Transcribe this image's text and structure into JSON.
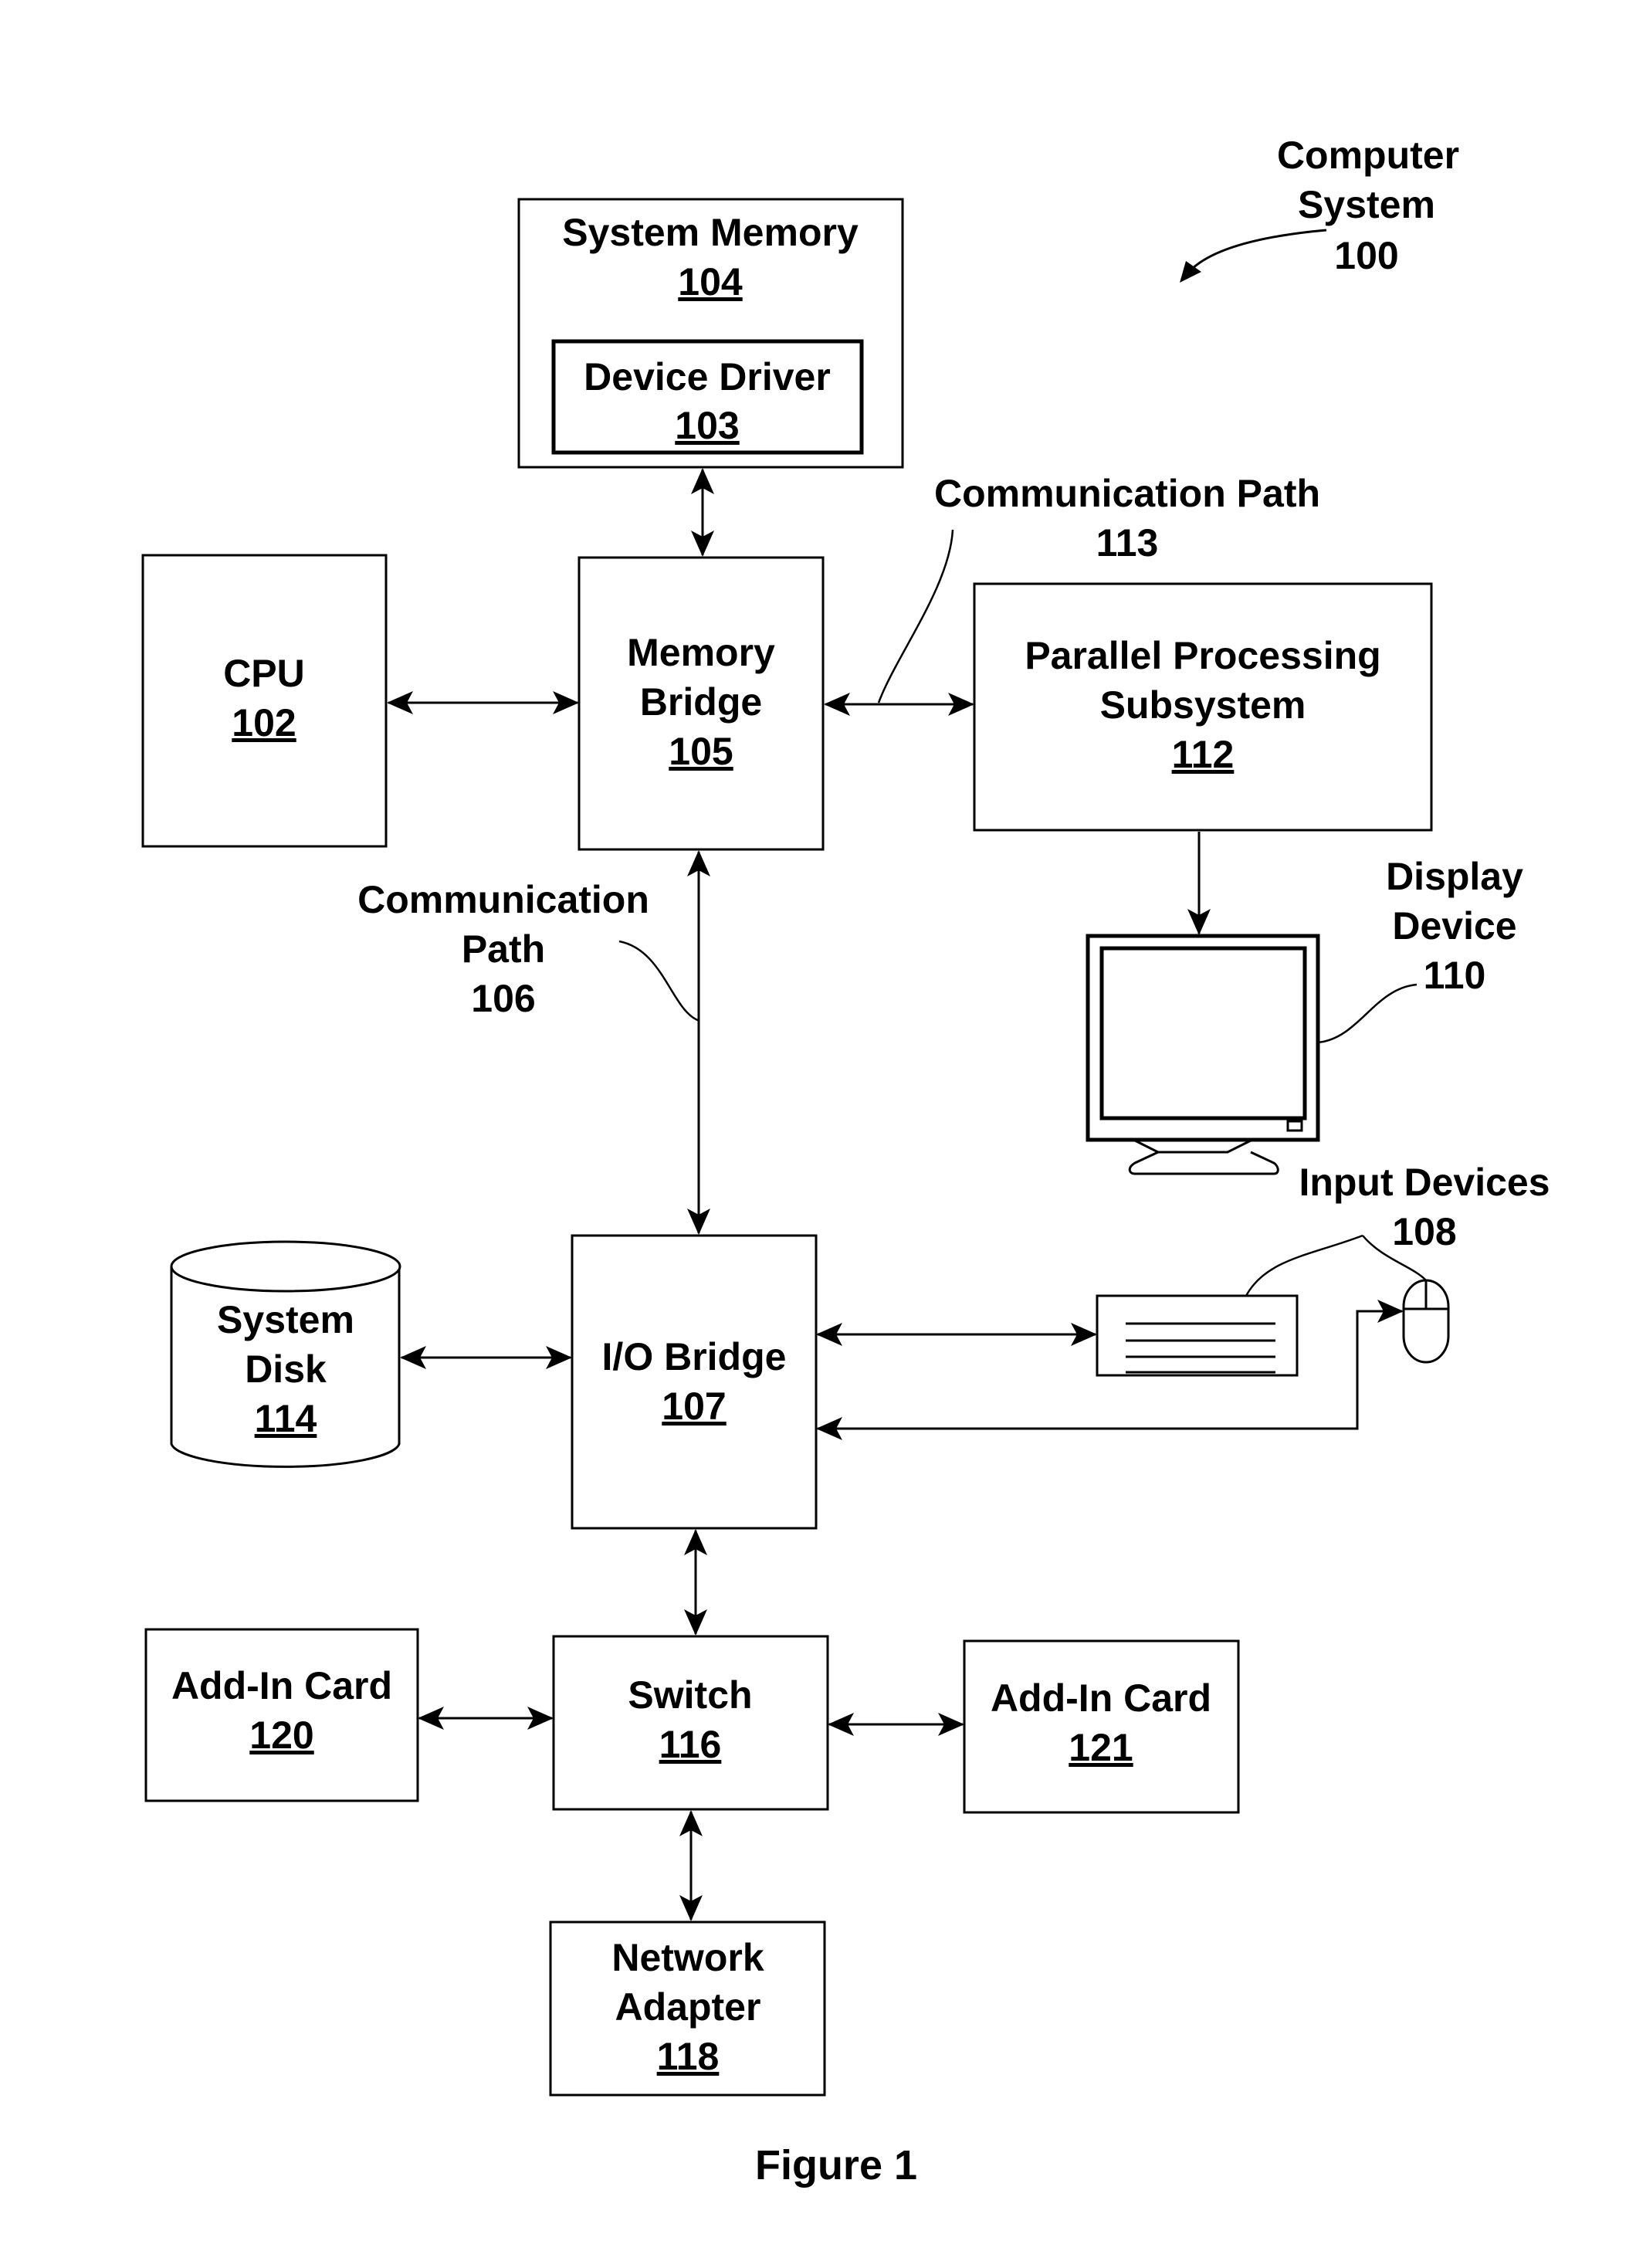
{
  "title": {
    "line1": "Computer",
    "line2": "System",
    "ref": "100"
  },
  "figure_caption": "Figure 1",
  "nodes": {
    "system_memory": {
      "lines": [
        "System Memory"
      ],
      "ref": "104"
    },
    "device_driver": {
      "lines": [
        "Device Driver"
      ],
      "ref": "103"
    },
    "cpu": {
      "lines": [
        "CPU"
      ],
      "ref": "102"
    },
    "memory_bridge": {
      "lines": [
        "Memory",
        "Bridge"
      ],
      "ref": "105"
    },
    "parallel_processing": {
      "lines": [
        "Parallel Processing",
        "Subsystem"
      ],
      "ref": "112"
    },
    "io_bridge": {
      "lines": [
        "I/O Bridge"
      ],
      "ref": "107"
    },
    "system_disk": {
      "lines": [
        "System",
        "Disk"
      ],
      "ref": "114"
    },
    "switch": {
      "lines": [
        "Switch"
      ],
      "ref": "116"
    },
    "add_in_card_120": {
      "lines": [
        "Add-In Card"
      ],
      "ref": "120"
    },
    "add_in_card_121": {
      "lines": [
        "Add-In Card"
      ],
      "ref": "121"
    },
    "network_adapter": {
      "lines": [
        "Network",
        "Adapter"
      ],
      "ref": "118"
    }
  },
  "callouts": {
    "comm_path_113": {
      "lines": [
        "Communication Path"
      ],
      "ref": "113"
    },
    "comm_path_106": {
      "lines": [
        "Communication",
        "Path"
      ],
      "ref": "106"
    },
    "display_device": {
      "lines": [
        "Display",
        "Device"
      ],
      "ref": "110"
    },
    "input_devices": {
      "lines": [
        "Input Devices"
      ],
      "ref": "108"
    }
  },
  "edges": [
    {
      "from": "system_memory",
      "to": "memory_bridge",
      "direction": "bidirectional"
    },
    {
      "from": "cpu",
      "to": "memory_bridge",
      "direction": "bidirectional"
    },
    {
      "from": "memory_bridge",
      "to": "parallel_processing",
      "direction": "bidirectional",
      "label": "comm_path_113"
    },
    {
      "from": "parallel_processing",
      "to": "display_device",
      "direction": "forward"
    },
    {
      "from": "memory_bridge",
      "to": "io_bridge",
      "direction": "bidirectional",
      "label": "comm_path_106"
    },
    {
      "from": "system_disk",
      "to": "io_bridge",
      "direction": "bidirectional"
    },
    {
      "from": "io_bridge",
      "to": "keyboard",
      "direction": "bidirectional"
    },
    {
      "from": "io_bridge",
      "to": "mouse",
      "direction": "bidirectional"
    },
    {
      "from": "io_bridge",
      "to": "switch",
      "direction": "bidirectional"
    },
    {
      "from": "add_in_card_120",
      "to": "switch",
      "direction": "bidirectional"
    },
    {
      "from": "switch",
      "to": "add_in_card_121",
      "direction": "bidirectional"
    },
    {
      "from": "switch",
      "to": "network_adapter",
      "direction": "bidirectional"
    }
  ]
}
